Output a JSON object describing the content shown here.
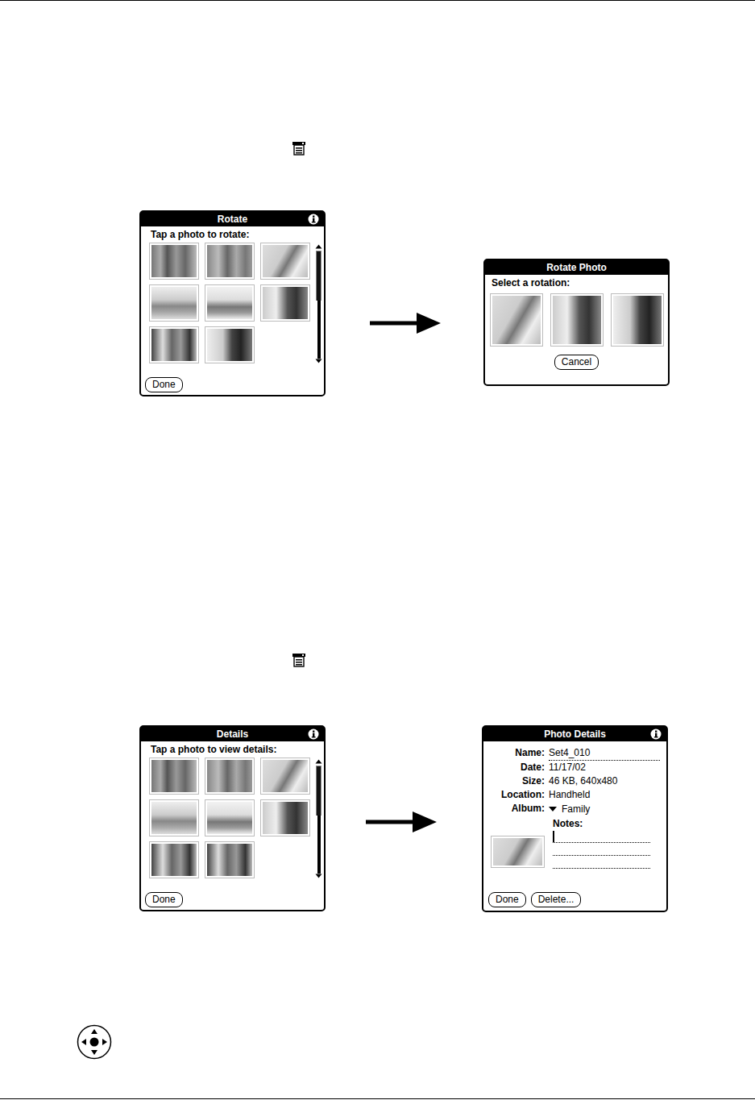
{
  "rotate_dialog": {
    "title": "Rotate",
    "prompt": "Tap a photo to rotate:",
    "button": "Done"
  },
  "rotate_photo_dialog": {
    "title": "Rotate Photo",
    "prompt": "Select a rotation:",
    "button": "Cancel"
  },
  "details_dialog": {
    "title": "Details",
    "prompt": "Tap a photo to view details:",
    "button": "Done"
  },
  "photo_details_dialog": {
    "title": "Photo Details",
    "fields": [
      {
        "label": "Name:",
        "value": "Set4_010",
        "kind": "textfield"
      },
      {
        "label": "Date:",
        "value": "11/17/02",
        "kind": "static"
      },
      {
        "label": "Size:",
        "value": "46 KB, 640x480",
        "kind": "static"
      },
      {
        "label": "Location:",
        "value": "Handheld",
        "kind": "static"
      },
      {
        "label": "Album:",
        "value": "Family",
        "kind": "dropdown"
      }
    ],
    "notes_label": "Notes:",
    "notes_focused": true,
    "buttons": [
      "Done",
      "Delete..."
    ]
  }
}
